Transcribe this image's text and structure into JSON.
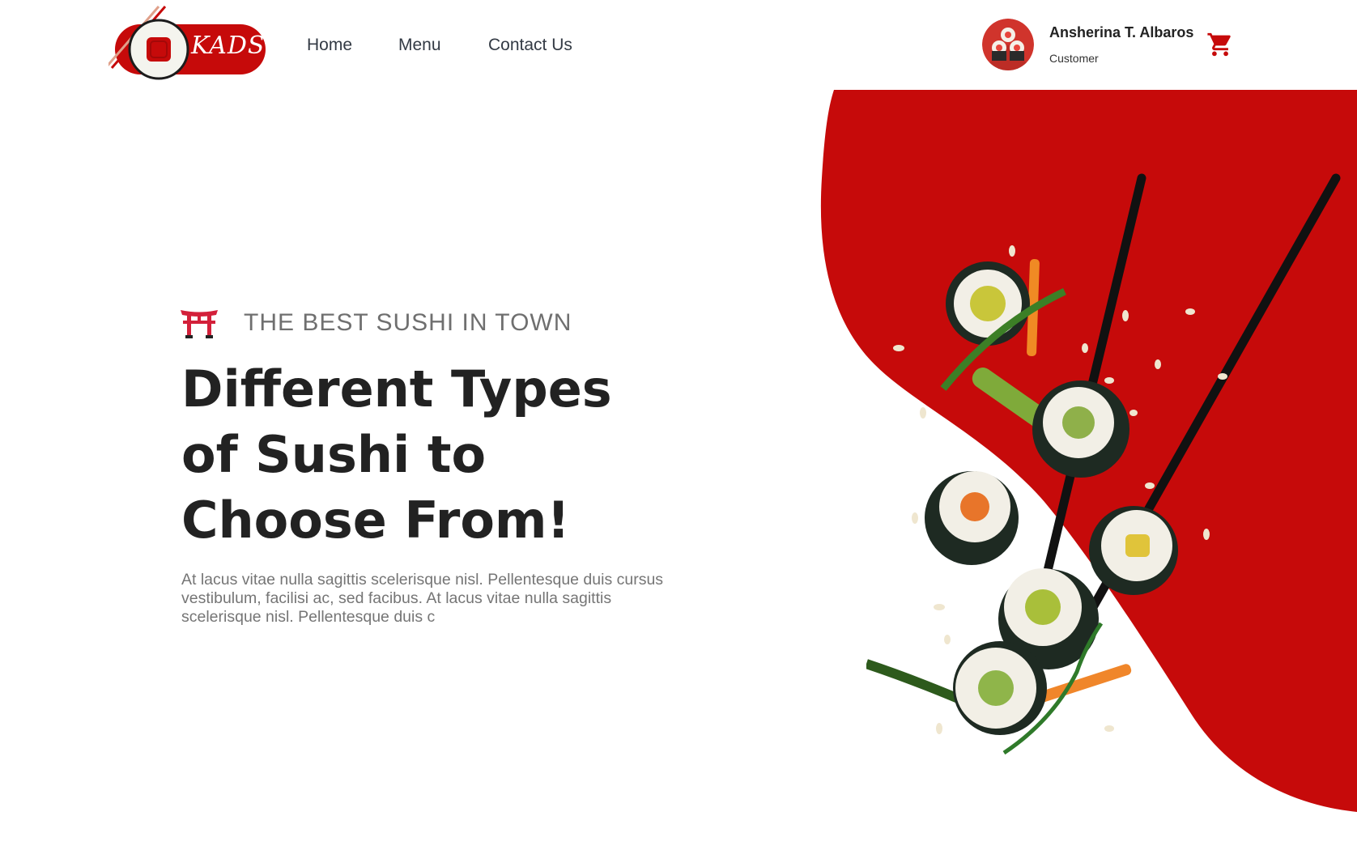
{
  "brand": {
    "logo_text": "KADS",
    "primary_color": "#c60a0a",
    "text_color": "#222222"
  },
  "nav": {
    "items": [
      {
        "label": "Home"
      },
      {
        "label": "Menu"
      },
      {
        "label": "Contact Us"
      }
    ]
  },
  "user": {
    "name": "Ansherina T. Albaros",
    "role": "Customer",
    "avatar_icon": "sushi-avatar-icon",
    "cart_icon": "shopping-cart-icon"
  },
  "hero": {
    "eyebrow_icon": "torii-gate-icon",
    "eyebrow": "THE BEST SUSHI IN TOWN",
    "title": "Different Types of Sushi to Choose From!",
    "body": "At lacus vitae nulla sagittis scelerisque nisl. Pellentesque duis cursus vestibulum, facilisi ac, sed facibus. At lacus vitae nulla sagittis scelerisque nisl. Pellentesque duis c",
    "image_icon": "flying-sushi-rolls-with-chopsticks"
  }
}
